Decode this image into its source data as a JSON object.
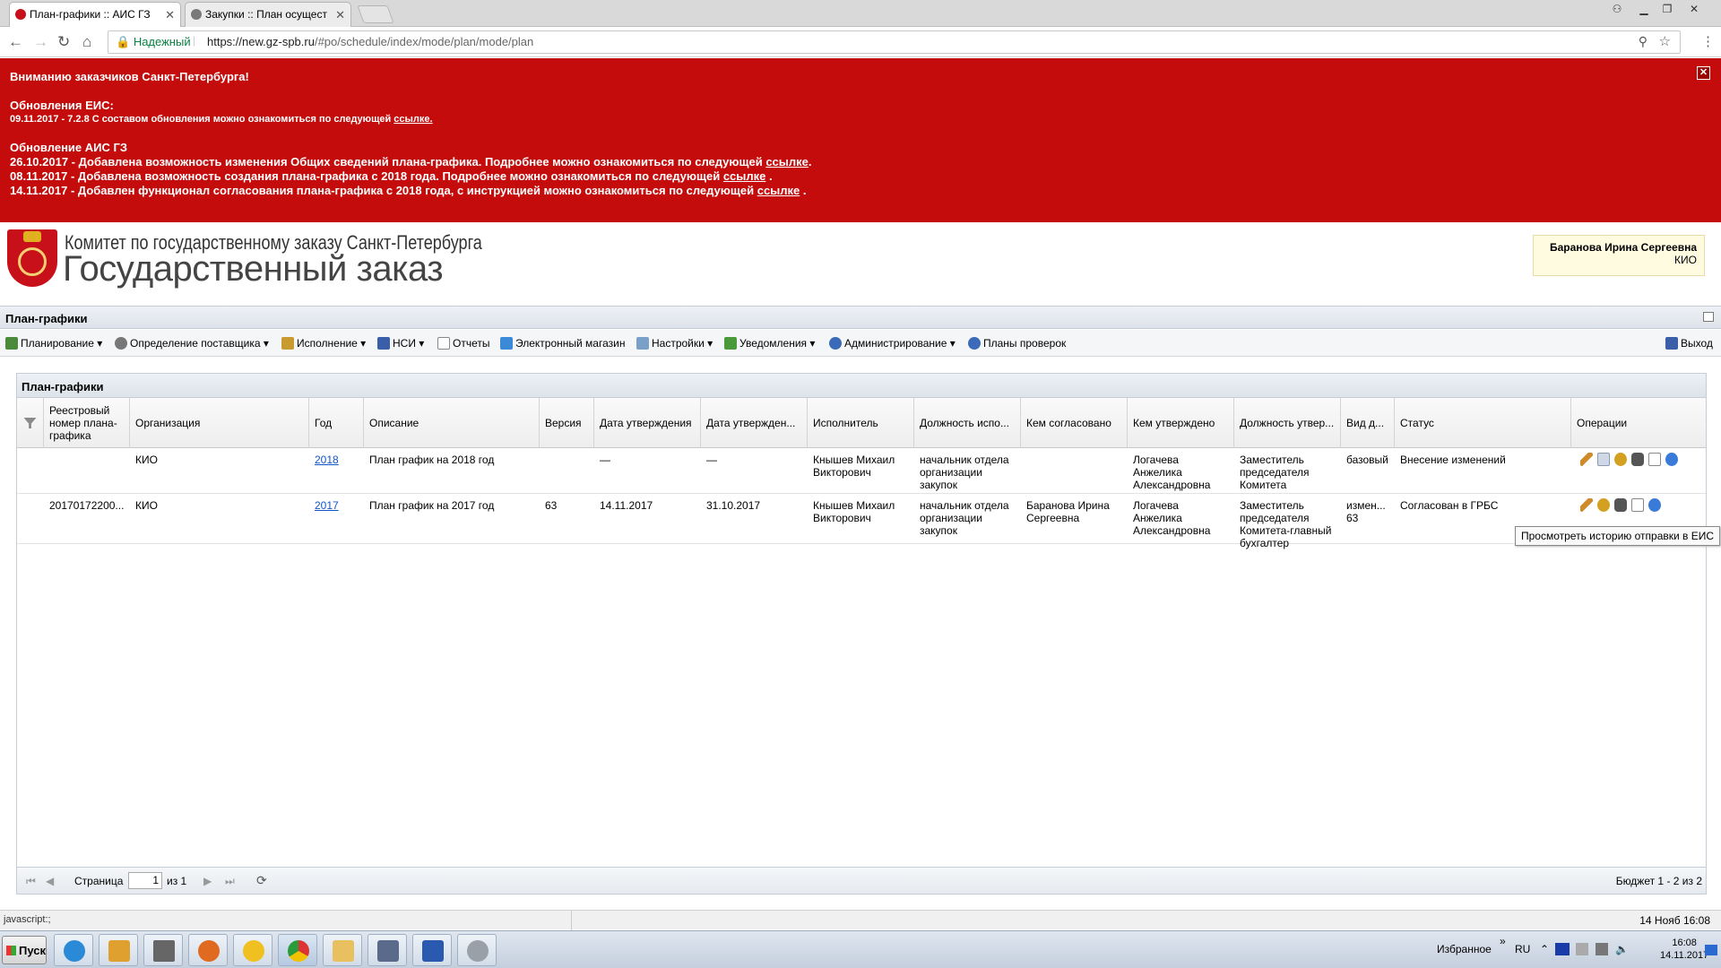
{
  "browser": {
    "tabs": [
      {
        "label": "План-графики :: АИС ГЗ",
        "close": "✕"
      },
      {
        "label": "Закупки :: План осущест",
        "close": "✕"
      }
    ],
    "secure_label": "Надежный",
    "url_host": "https://new.gz-spb.ru",
    "url_path": "/#po/schedule/index/mode/plan/mode/plan"
  },
  "banner": {
    "heading": "Вниманию заказчиков Санкт-Петербурга!",
    "eis_title": "Обновления ЕИС:",
    "eis_line": "09.11.2017 - 7.2.8 С составом обновления можно ознакомиться по следующей",
    "eis_link": "ссылке.",
    "ais_title": "Обновление АИС ГЗ",
    "ais_lines": [
      {
        "text": "26.10.2017 - Добавлена возможность изменения Общих сведений плана-графика. Подробнее можно ознакомиться по следующей",
        "link": "ссылке",
        "tail": "."
      },
      {
        "text": "08.11.2017 - Добавлена возможность создания плана-графика с 2018 года. Подробнее можно ознакомиться по следующей",
        "link": "ссылке",
        "tail": " ."
      },
      {
        "text": "14.11.2017 - Добавлен функционал согласования плана-графика с 2018 года, с инструкцией можно ознакомиться по следующей",
        "link": "ссылке",
        "tail": " ."
      }
    ]
  },
  "header": {
    "logo_line1": "Комитет по государственному заказу Санкт-Петербурга",
    "logo_line2": "Государственный заказ",
    "user_name": "Баранова Ирина Сергеевна",
    "user_org": "КИО"
  },
  "panel": {
    "title": "План-графики"
  },
  "toolbar": {
    "items": [
      "Планирование",
      "Определение поставщика",
      "Исполнение",
      "НСИ",
      "Отчеты",
      "Электронный магазин",
      "Настройки",
      "Уведомления",
      "Администрирование",
      "Планы проверок"
    ],
    "exit": "Выход"
  },
  "grid": {
    "title": "План-графики",
    "columns": [
      "Реестровый номер плана-графика",
      "Организация",
      "Год",
      "Описание",
      "Версия",
      "Дата утверждения",
      "Дата утвержден...",
      "Исполнитель",
      "Должность испо...",
      "Кем согласовано",
      "Кем утверждено",
      "Должность утвер...",
      "Вид д...",
      "Статус",
      "Операции"
    ],
    "rows": [
      {
        "reg": "",
        "org": "КИО",
        "year": "2018",
        "desc": "План график на 2018 год",
        "version": "",
        "date1": "—",
        "date2": "—",
        "executor": "Кнышев Михаил Викторович",
        "exec_pos": "начальник отдела организации закупок",
        "agreed": "",
        "approved": "Логачева Анжелика Александровна",
        "appr_pos": "Заместитель председателя Комитета",
        "kind": "базовый",
        "status": "Внесение изменений"
      },
      {
        "reg": "20170172200...",
        "org": "КИО",
        "year": "2017",
        "desc": "План график на 2017 год",
        "version": "63",
        "date1": "14.11.2017",
        "date2": "31.10.2017",
        "executor": "Кнышев Михаил Викторович",
        "exec_pos": "начальник отдела организации закупок",
        "agreed": "Баранова Ирина Сергеевна",
        "approved": "Логачева Анжелика Александровна",
        "appr_pos": "Заместитель председателя Комитета-главный бухгалтер",
        "kind": "измен... 63",
        "status": "Согласован в ГРБС"
      }
    ],
    "tooltip": "Просмотреть историю отправки в ЕИС",
    "pager": {
      "page_label": "Страница",
      "page_value": "1",
      "of_label": "из 1",
      "summary": "Бюджет 1 - 2 из 2"
    }
  },
  "statusbar": {
    "url": "javascript:;",
    "datetime": "14 Нояб 16:08"
  },
  "taskbar": {
    "start": "Пуск",
    "favorites": "Избранное",
    "lang": "RU",
    "time": "16:08",
    "date": "14.11.2017"
  },
  "colors": {
    "banner": "#c40c0c",
    "link": "#1155cc"
  }
}
